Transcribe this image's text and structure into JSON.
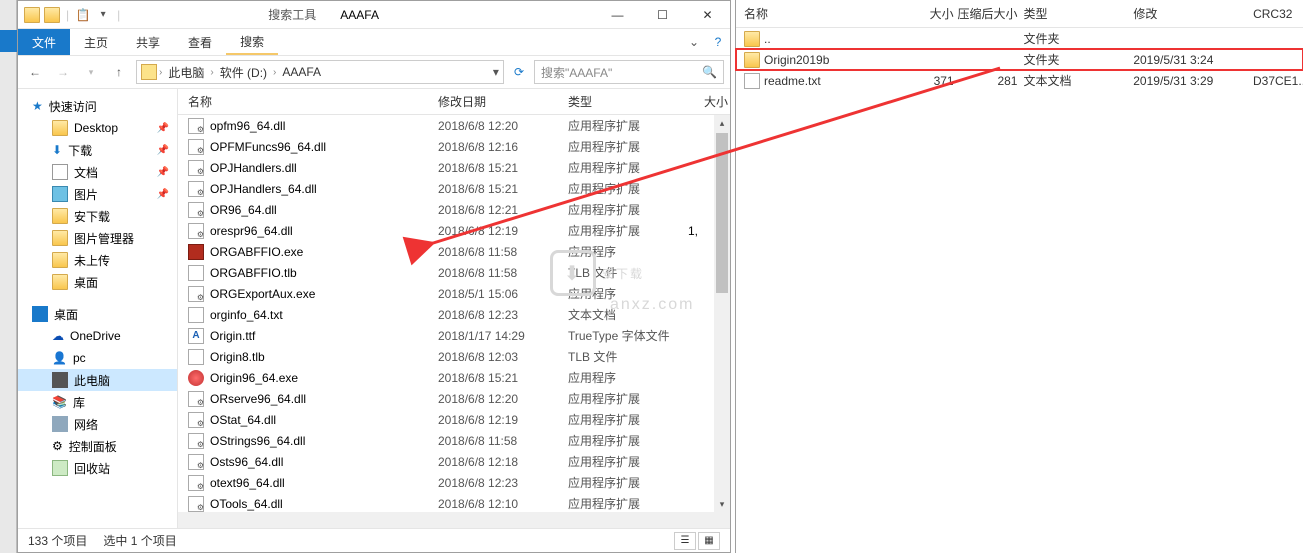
{
  "titlebar": {
    "search_tool": "搜索工具",
    "folder_name": "AAAFA"
  },
  "winbuttons": {
    "min": "—",
    "max": "☐",
    "close": "✕"
  },
  "tabs": {
    "file": "文件",
    "home": "主页",
    "share": "共享",
    "view": "查看",
    "search": "搜索"
  },
  "breadcrumb": {
    "pc": "此电脑",
    "drive": "软件 (D:)",
    "folder": "AAAFA"
  },
  "search": {
    "placeholder": "搜索\"AAAFA\""
  },
  "tree": {
    "quick": "快速访问",
    "desktop": "Desktop",
    "downloads": "下载",
    "documents": "文档",
    "pictures": "图片",
    "anxz": "安下载",
    "picmgr": "图片管理器",
    "unupload": "未上传",
    "desk2": "桌面",
    "desk_header": "桌面",
    "onedrive": "OneDrive",
    "pc_item": "pc",
    "thispc": "此电脑",
    "lib": "库",
    "network": "网络",
    "control": "控制面板",
    "recycle": "回收站"
  },
  "cols": {
    "name": "名称",
    "date": "修改日期",
    "type": "类型",
    "size": "大小"
  },
  "files": [
    {
      "icon": "dll",
      "name": "opfm96_64.dll",
      "date": "2018/6/8 12:20",
      "type": "应用程序扩展"
    },
    {
      "icon": "dll",
      "name": "OPFMFuncs96_64.dll",
      "date": "2018/6/8 12:16",
      "type": "应用程序扩展"
    },
    {
      "icon": "dll",
      "name": "OPJHandlers.dll",
      "date": "2018/6/8 15:21",
      "type": "应用程序扩展"
    },
    {
      "icon": "dll",
      "name": "OPJHandlers_64.dll",
      "date": "2018/6/8 15:21",
      "type": "应用程序扩展"
    },
    {
      "icon": "dll",
      "name": "OR96_64.dll",
      "date": "2018/6/8 12:21",
      "type": "应用程序扩展"
    },
    {
      "icon": "dll",
      "name": "orespr96_64.dll",
      "date": "2018/6/8 12:19",
      "type": "应用程序扩展",
      "size": "1,"
    },
    {
      "icon": "exe-logo",
      "name": "ORGABFFIO.exe",
      "date": "2018/6/8 11:58",
      "type": "应用程序"
    },
    {
      "icon": "txt",
      "name": "ORGABFFIO.tlb",
      "date": "2018/6/8 11:58",
      "type": "TLB 文件"
    },
    {
      "icon": "dll",
      "name": "ORGExportAux.exe",
      "date": "2018/5/1 15:06",
      "type": "应用程序"
    },
    {
      "icon": "txt",
      "name": "orginfo_64.txt",
      "date": "2018/6/8 12:23",
      "type": "文本文档"
    },
    {
      "icon": "ttf",
      "name": "Origin.ttf",
      "date": "2018/1/17 14:29",
      "type": "TrueType 字体文件"
    },
    {
      "icon": "txt",
      "name": "Origin8.tlb",
      "date": "2018/6/8 12:03",
      "type": "TLB 文件"
    },
    {
      "icon": "exe-red",
      "name": "Origin96_64.exe",
      "date": "2018/6/8 15:21",
      "type": "应用程序"
    },
    {
      "icon": "dll",
      "name": "ORserve96_64.dll",
      "date": "2018/6/8 12:20",
      "type": "应用程序扩展"
    },
    {
      "icon": "dll",
      "name": "OStat_64.dll",
      "date": "2018/6/8 12:19",
      "type": "应用程序扩展"
    },
    {
      "icon": "dll",
      "name": "OStrings96_64.dll",
      "date": "2018/6/8 11:58",
      "type": "应用程序扩展"
    },
    {
      "icon": "dll",
      "name": "Osts96_64.dll",
      "date": "2018/6/8 12:18",
      "type": "应用程序扩展"
    },
    {
      "icon": "dll",
      "name": "otext96_64.dll",
      "date": "2018/6/8 12:23",
      "type": "应用程序扩展"
    },
    {
      "icon": "dll",
      "name": "OTools_64.dll",
      "date": "2018/6/8 12:10",
      "type": "应用程序扩展"
    }
  ],
  "status": {
    "count": "133 个项目",
    "selected": "选中 1 个项目"
  },
  "right": {
    "cols": {
      "name": "名称",
      "size": "大小",
      "csize": "压缩后大小",
      "type": "类型",
      "mod": "修改",
      "crc": "CRC32"
    },
    "rows": [
      {
        "icon": "folder",
        "name": "..",
        "type": "文件夹",
        "size": "",
        "csize": "",
        "mod": "",
        "crc": ""
      },
      {
        "icon": "folder",
        "name": "Origin2019b",
        "type": "文件夹",
        "size": "",
        "csize": "",
        "mod": "2019/5/31 3:24",
        "crc": "",
        "hl": true
      },
      {
        "icon": "txt",
        "name": "readme.txt",
        "size": "371",
        "csize": "281",
        "type": "文本文档",
        "mod": "2019/5/31 3:29",
        "crc": "D37CE1..."
      }
    ]
  },
  "watermark": {
    "cn": "安下载",
    "en": "anxz.com"
  }
}
